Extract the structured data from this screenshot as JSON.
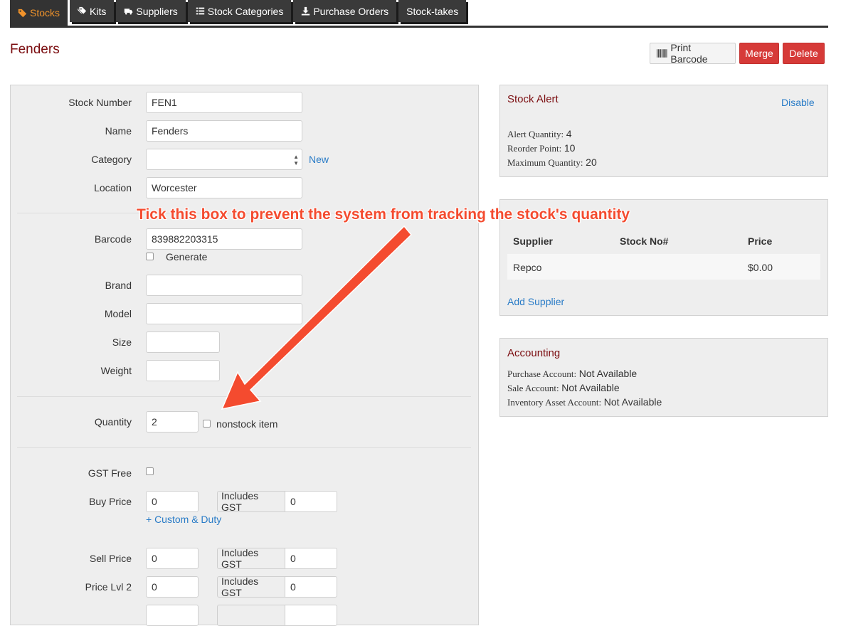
{
  "colors": {
    "accent": "#f0932b",
    "title": "#7b0d10",
    "danger": "#d63a38",
    "link": "#2a7cc7",
    "annotation": "#f44b2f"
  },
  "tabs": [
    {
      "label": "Stocks",
      "icon": "tag-icon",
      "active": true
    },
    {
      "label": "Kits",
      "icon": "tags-icon"
    },
    {
      "label": "Suppliers",
      "icon": "truck-icon"
    },
    {
      "label": "Stock Categories",
      "icon": "list-icon"
    },
    {
      "label": "Purchase Orders",
      "icon": "download-icon"
    },
    {
      "label": "Stock-takes"
    }
  ],
  "header": {
    "title": "Fenders",
    "print_barcode": "Print Barcode",
    "merge": "Merge",
    "delete": "Delete"
  },
  "form": {
    "stock_number": {
      "label": "Stock Number",
      "value": "FEN1"
    },
    "name": {
      "label": "Name",
      "value": "Fenders"
    },
    "category": {
      "label": "Category",
      "value": "",
      "new_link": "New"
    },
    "location": {
      "label": "Location",
      "value": "Worcester"
    },
    "barcode": {
      "label": "Barcode",
      "value": "839882203315",
      "generate": "Generate"
    },
    "brand": {
      "label": "Brand",
      "value": ""
    },
    "model": {
      "label": "Model",
      "value": ""
    },
    "size": {
      "label": "Size",
      "value": ""
    },
    "weight": {
      "label": "Weight",
      "value": ""
    },
    "quantity": {
      "label": "Quantity",
      "value": "2",
      "nonstock_label": "nonstock item"
    },
    "gst_free": {
      "label": "GST Free"
    },
    "buy_price": {
      "label": "Buy Price",
      "value": "0",
      "includes_gst_label": "Includes GST",
      "includes_gst_value": "0",
      "custom_duty_link": "+ Custom & Duty"
    },
    "sell_price": {
      "label": "Sell Price",
      "value": "0",
      "includes_gst_label": "Includes GST",
      "includes_gst_value": "0"
    },
    "price_lvl2": {
      "label": "Price Lvl 2",
      "value": "0",
      "includes_gst_label": "Includes GST",
      "includes_gst_value": "0"
    }
  },
  "stock_alert": {
    "title": "Stock Alert",
    "disable_link": "Disable",
    "alert_quantity": {
      "label": "Alert Quantity:",
      "value": "4"
    },
    "reorder_point": {
      "label": "Reorder Point:",
      "value": "10"
    },
    "maximum_quantity": {
      "label": "Maximum Quantity:",
      "value": "20"
    }
  },
  "suppliers": {
    "columns": [
      "Supplier",
      "Stock No#",
      "Price"
    ],
    "rows": [
      {
        "supplier": "Repco",
        "stock_no": "",
        "price": "$0.00"
      }
    ],
    "add_link": "Add Supplier"
  },
  "accounting": {
    "title": "Accounting",
    "purchase_account": {
      "label": "Purchase Account:",
      "value": "Not Available"
    },
    "sale_account": {
      "label": "Sale Account:",
      "value": "Not Available"
    },
    "inventory_asset_account": {
      "label": "Inventory Asset Account:",
      "value": "Not Available"
    }
  },
  "annotation": {
    "text": "Tick this box to prevent the system from tracking the stock's quantity"
  }
}
